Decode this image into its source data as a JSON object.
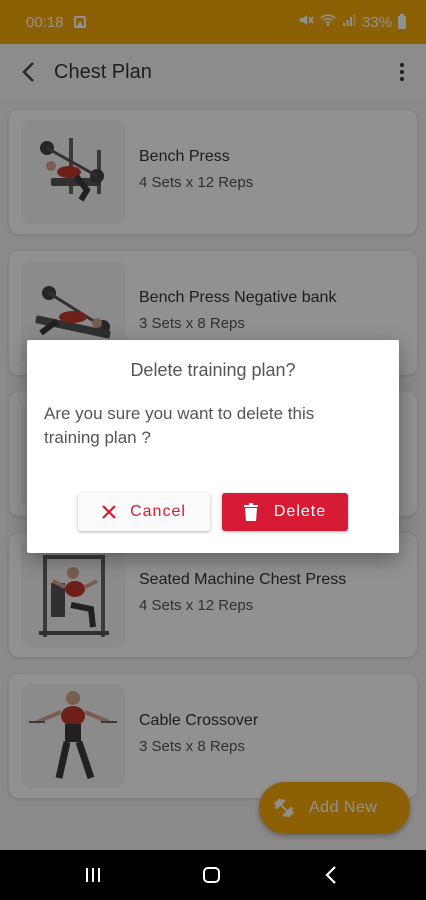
{
  "status_bar": {
    "time": "00:18",
    "battery": "33%",
    "icons": [
      "image-icon",
      "mute-icon",
      "wifi-icon",
      "signal-icon",
      "battery-icon"
    ]
  },
  "app_bar": {
    "title": "Chest Plan",
    "back_icon": "back-arrow-icon",
    "menu_icon": "more-vert-icon"
  },
  "exercises": [
    {
      "name": "Bench Press",
      "detail": "4 Sets x 12 Reps"
    },
    {
      "name": "Bench Press Negative bank",
      "detail": "3 Sets x 8 Reps"
    },
    {
      "name": "",
      "detail": ""
    },
    {
      "name": "Seated Machine Chest Press",
      "detail": "4 Sets x 12 Reps"
    },
    {
      "name": "Cable Crossover",
      "detail": "3 Sets x 8 Reps"
    }
  ],
  "fab": {
    "label": "Add New",
    "icon": "dumbbell-icon"
  },
  "dialog": {
    "title": "Delete training plan?",
    "message": "Are you sure you want to delete this training plan ?",
    "cancel_label": "Cancel",
    "delete_label": "Delete"
  },
  "colors": {
    "primary": "#f7ab0b",
    "danger": "#d81b35",
    "scrim": "#000000"
  }
}
